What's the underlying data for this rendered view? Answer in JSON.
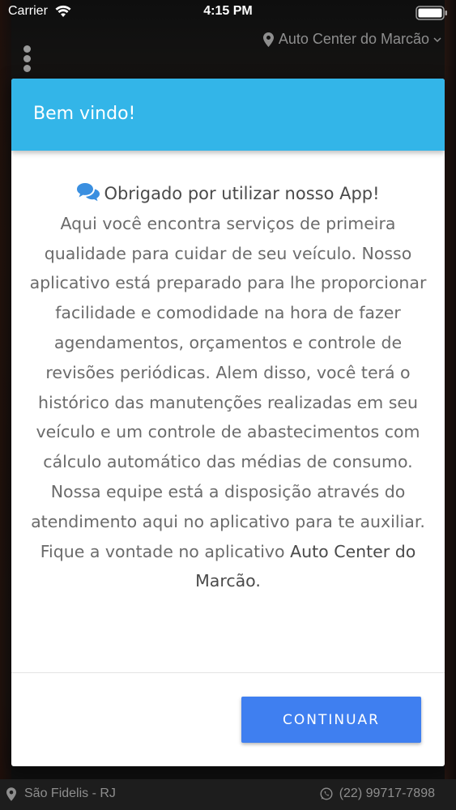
{
  "status_bar": {
    "carrier": "Carrier",
    "time": "4:15 PM"
  },
  "header": {
    "location_name": "Auto Center do Marcão"
  },
  "modal": {
    "title": "Bem vindo!",
    "heading": "Obrigado por utilizar nosso App!",
    "body_text": "Aqui você encontra serviços de primeira qualidade para cuidar de seu veículo. Nosso aplicativo está preparado para lhe proporcionar facilidade e comodidade na hora de fazer agendamentos, orçamentos e controle de revisões periódicas. Alem disso, você terá o histórico das manutenções realizadas em seu veículo e um controle de abastecimentos com cálculo automático das médias de consumo. Nossa equipe está a disposição através do atendimento aqui no aplicativo para te auxiliar. Fique a vontade no aplicativo",
    "brand_name": "Auto Center do Marcão",
    "brand_suffix": ".",
    "continue_label": "CONTINUAR"
  },
  "footer": {
    "city": "São Fidelis - RJ",
    "phone": "(22) 99717-7898"
  },
  "colors": {
    "modal_header": "#33b5e8",
    "continue_button": "#3f7ff0",
    "chat_icon": "#3a8fe0"
  },
  "icons": {
    "wifi": "wifi-icon",
    "battery": "battery-icon",
    "menu": "more-vertical-icon",
    "location": "map-pin-icon",
    "chevron": "chevron-down-icon",
    "chat": "chat-bubbles-icon",
    "whatsapp": "whatsapp-icon"
  }
}
